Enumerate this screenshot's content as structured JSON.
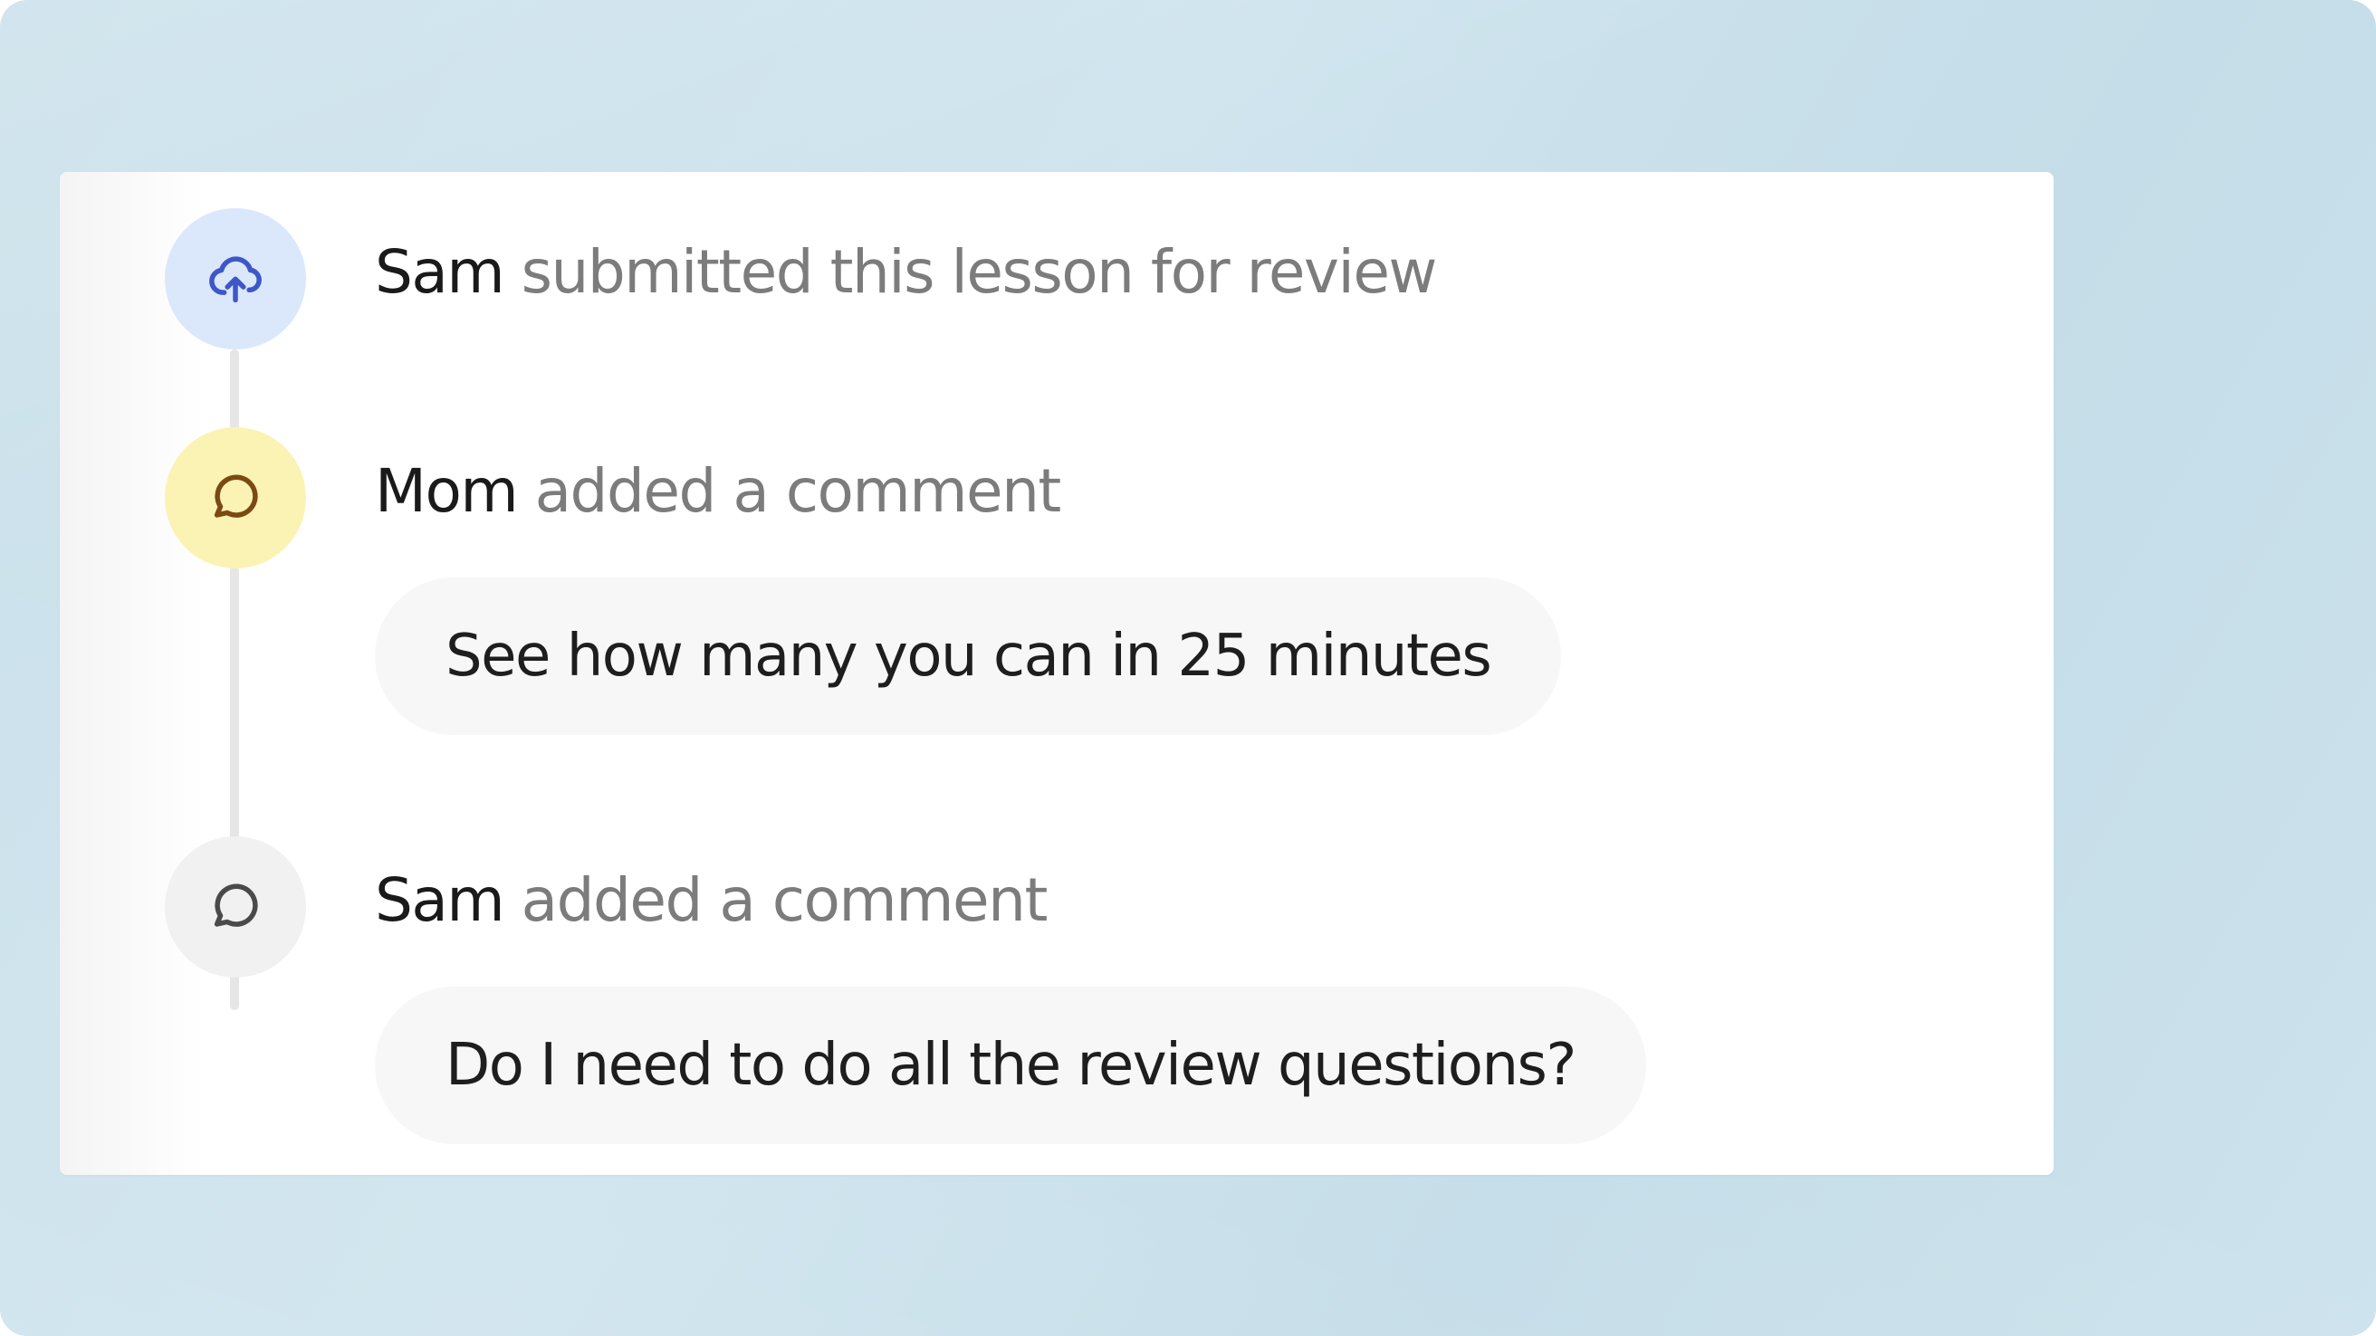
{
  "timeline": [
    {
      "actor": "Sam",
      "action": "submitted this lesson for review",
      "icon": "cloud-upload-icon",
      "icon_color": "#3d57c8",
      "circle_color": "#dbe7fb"
    },
    {
      "actor": "Mom",
      "action": "added a comment",
      "icon": "comment-icon",
      "icon_color": "#7a4a12",
      "circle_color": "#fbf3b4",
      "comment": "See how many you can in 25 minutes"
    },
    {
      "actor": "Sam",
      "action": "added a comment",
      "icon": "comment-icon",
      "icon_color": "#4a4a4a",
      "circle_color": "#f1f1f1",
      "comment": "Do I need to do all the review questions?"
    }
  ]
}
